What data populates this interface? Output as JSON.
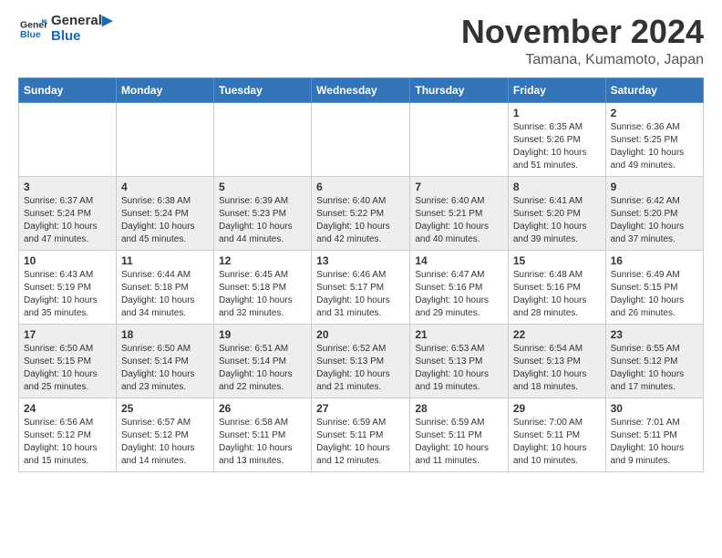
{
  "header": {
    "logo_line1": "General",
    "logo_line2": "Blue",
    "month_title": "November 2024",
    "location": "Tamana, Kumamoto, Japan"
  },
  "days_of_week": [
    "Sunday",
    "Monday",
    "Tuesday",
    "Wednesday",
    "Thursday",
    "Friday",
    "Saturday"
  ],
  "weeks": [
    {
      "row": 1,
      "days": [
        {
          "num": "",
          "info": ""
        },
        {
          "num": "",
          "info": ""
        },
        {
          "num": "",
          "info": ""
        },
        {
          "num": "",
          "info": ""
        },
        {
          "num": "",
          "info": ""
        },
        {
          "num": "1",
          "info": "Sunrise: 6:35 AM\nSunset: 5:26 PM\nDaylight: 10 hours\nand 51 minutes."
        },
        {
          "num": "2",
          "info": "Sunrise: 6:36 AM\nSunset: 5:25 PM\nDaylight: 10 hours\nand 49 minutes."
        }
      ]
    },
    {
      "row": 2,
      "days": [
        {
          "num": "3",
          "info": "Sunrise: 6:37 AM\nSunset: 5:24 PM\nDaylight: 10 hours\nand 47 minutes."
        },
        {
          "num": "4",
          "info": "Sunrise: 6:38 AM\nSunset: 5:24 PM\nDaylight: 10 hours\nand 45 minutes."
        },
        {
          "num": "5",
          "info": "Sunrise: 6:39 AM\nSunset: 5:23 PM\nDaylight: 10 hours\nand 44 minutes."
        },
        {
          "num": "6",
          "info": "Sunrise: 6:40 AM\nSunset: 5:22 PM\nDaylight: 10 hours\nand 42 minutes."
        },
        {
          "num": "7",
          "info": "Sunrise: 6:40 AM\nSunset: 5:21 PM\nDaylight: 10 hours\nand 40 minutes."
        },
        {
          "num": "8",
          "info": "Sunrise: 6:41 AM\nSunset: 5:20 PM\nDaylight: 10 hours\nand 39 minutes."
        },
        {
          "num": "9",
          "info": "Sunrise: 6:42 AM\nSunset: 5:20 PM\nDaylight: 10 hours\nand 37 minutes."
        }
      ]
    },
    {
      "row": 3,
      "days": [
        {
          "num": "10",
          "info": "Sunrise: 6:43 AM\nSunset: 5:19 PM\nDaylight: 10 hours\nand 35 minutes."
        },
        {
          "num": "11",
          "info": "Sunrise: 6:44 AM\nSunset: 5:18 PM\nDaylight: 10 hours\nand 34 minutes."
        },
        {
          "num": "12",
          "info": "Sunrise: 6:45 AM\nSunset: 5:18 PM\nDaylight: 10 hours\nand 32 minutes."
        },
        {
          "num": "13",
          "info": "Sunrise: 6:46 AM\nSunset: 5:17 PM\nDaylight: 10 hours\nand 31 minutes."
        },
        {
          "num": "14",
          "info": "Sunrise: 6:47 AM\nSunset: 5:16 PM\nDaylight: 10 hours\nand 29 minutes."
        },
        {
          "num": "15",
          "info": "Sunrise: 6:48 AM\nSunset: 5:16 PM\nDaylight: 10 hours\nand 28 minutes."
        },
        {
          "num": "16",
          "info": "Sunrise: 6:49 AM\nSunset: 5:15 PM\nDaylight: 10 hours\nand 26 minutes."
        }
      ]
    },
    {
      "row": 4,
      "days": [
        {
          "num": "17",
          "info": "Sunrise: 6:50 AM\nSunset: 5:15 PM\nDaylight: 10 hours\nand 25 minutes."
        },
        {
          "num": "18",
          "info": "Sunrise: 6:50 AM\nSunset: 5:14 PM\nDaylight: 10 hours\nand 23 minutes."
        },
        {
          "num": "19",
          "info": "Sunrise: 6:51 AM\nSunset: 5:14 PM\nDaylight: 10 hours\nand 22 minutes."
        },
        {
          "num": "20",
          "info": "Sunrise: 6:52 AM\nSunset: 5:13 PM\nDaylight: 10 hours\nand 21 minutes."
        },
        {
          "num": "21",
          "info": "Sunrise: 6:53 AM\nSunset: 5:13 PM\nDaylight: 10 hours\nand 19 minutes."
        },
        {
          "num": "22",
          "info": "Sunrise: 6:54 AM\nSunset: 5:13 PM\nDaylight: 10 hours\nand 18 minutes."
        },
        {
          "num": "23",
          "info": "Sunrise: 6:55 AM\nSunset: 5:12 PM\nDaylight: 10 hours\nand 17 minutes."
        }
      ]
    },
    {
      "row": 5,
      "days": [
        {
          "num": "24",
          "info": "Sunrise: 6:56 AM\nSunset: 5:12 PM\nDaylight: 10 hours\nand 15 minutes."
        },
        {
          "num": "25",
          "info": "Sunrise: 6:57 AM\nSunset: 5:12 PM\nDaylight: 10 hours\nand 14 minutes."
        },
        {
          "num": "26",
          "info": "Sunrise: 6:58 AM\nSunset: 5:11 PM\nDaylight: 10 hours\nand 13 minutes."
        },
        {
          "num": "27",
          "info": "Sunrise: 6:59 AM\nSunset: 5:11 PM\nDaylight: 10 hours\nand 12 minutes."
        },
        {
          "num": "28",
          "info": "Sunrise: 6:59 AM\nSunset: 5:11 PM\nDaylight: 10 hours\nand 11 minutes."
        },
        {
          "num": "29",
          "info": "Sunrise: 7:00 AM\nSunset: 5:11 PM\nDaylight: 10 hours\nand 10 minutes."
        },
        {
          "num": "30",
          "info": "Sunrise: 7:01 AM\nSunset: 5:11 PM\nDaylight: 10 hours\nand 9 minutes."
        }
      ]
    }
  ]
}
